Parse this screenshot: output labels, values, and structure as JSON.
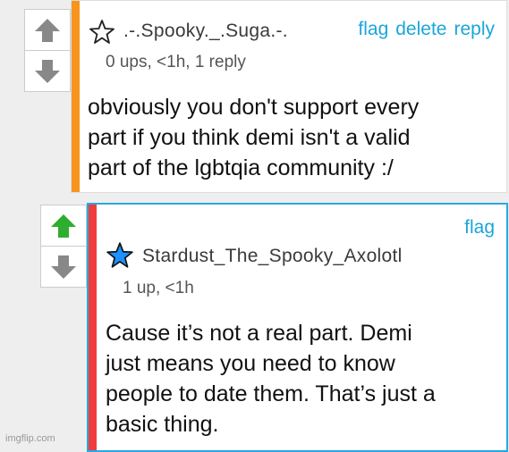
{
  "comments": [
    {
      "username": ".-.Spooky._.Suga.-.",
      "meta": "0 ups, <1h, 1 reply",
      "actions": {
        "flag": "flag",
        "delete": "delete",
        "reply": "reply"
      },
      "body": "obviously you don't support every\npart if you think demi isn't a valid\npart of the lgbtqia community :/",
      "stripe_color": "#f7941d",
      "star": "outline",
      "upvote_color": "#888888"
    },
    {
      "username": "Stardust_The_Spooky_Axolotl",
      "meta": "1 up, <1h",
      "actions": {
        "flag": "flag"
      },
      "body": "Cause it’s not a real part. Demi\njust means you need to know\npeople to date them. That’s just a\nbasic thing.",
      "stripe_color": "#ef3d3d",
      "star": "filled-blue",
      "upvote_color": "#2eae2e"
    }
  ],
  "watermark": "imgflip.com",
  "colors": {
    "link": "#1aa6d9",
    "star_fill": "#1e90ff",
    "selected_border": "#27a9e1"
  }
}
